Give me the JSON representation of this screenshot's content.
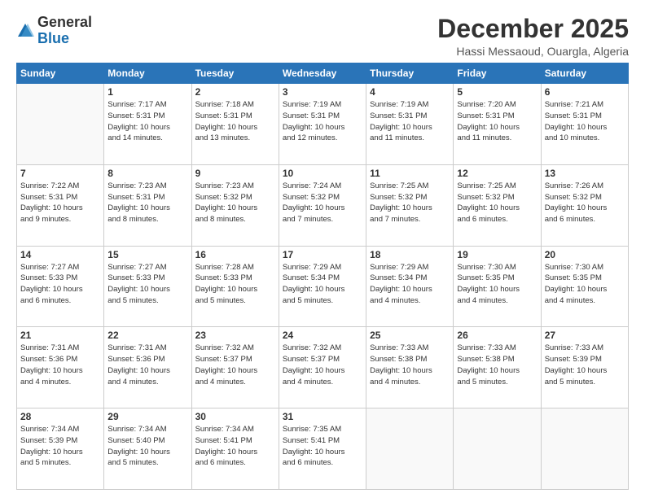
{
  "logo": {
    "general": "General",
    "blue": "Blue"
  },
  "header": {
    "month": "December 2025",
    "location": "Hassi Messaoud, Ouargla, Algeria"
  },
  "days_of_week": [
    "Sunday",
    "Monday",
    "Tuesday",
    "Wednesday",
    "Thursday",
    "Friday",
    "Saturday"
  ],
  "weeks": [
    [
      {
        "day": "",
        "info": ""
      },
      {
        "day": "1",
        "info": "Sunrise: 7:17 AM\nSunset: 5:31 PM\nDaylight: 10 hours\nand 14 minutes."
      },
      {
        "day": "2",
        "info": "Sunrise: 7:18 AM\nSunset: 5:31 PM\nDaylight: 10 hours\nand 13 minutes."
      },
      {
        "day": "3",
        "info": "Sunrise: 7:19 AM\nSunset: 5:31 PM\nDaylight: 10 hours\nand 12 minutes."
      },
      {
        "day": "4",
        "info": "Sunrise: 7:19 AM\nSunset: 5:31 PM\nDaylight: 10 hours\nand 11 minutes."
      },
      {
        "day": "5",
        "info": "Sunrise: 7:20 AM\nSunset: 5:31 PM\nDaylight: 10 hours\nand 11 minutes."
      },
      {
        "day": "6",
        "info": "Sunrise: 7:21 AM\nSunset: 5:31 PM\nDaylight: 10 hours\nand 10 minutes."
      }
    ],
    [
      {
        "day": "7",
        "info": "Sunrise: 7:22 AM\nSunset: 5:31 PM\nDaylight: 10 hours\nand 9 minutes."
      },
      {
        "day": "8",
        "info": "Sunrise: 7:23 AM\nSunset: 5:31 PM\nDaylight: 10 hours\nand 8 minutes."
      },
      {
        "day": "9",
        "info": "Sunrise: 7:23 AM\nSunset: 5:32 PM\nDaylight: 10 hours\nand 8 minutes."
      },
      {
        "day": "10",
        "info": "Sunrise: 7:24 AM\nSunset: 5:32 PM\nDaylight: 10 hours\nand 7 minutes."
      },
      {
        "day": "11",
        "info": "Sunrise: 7:25 AM\nSunset: 5:32 PM\nDaylight: 10 hours\nand 7 minutes."
      },
      {
        "day": "12",
        "info": "Sunrise: 7:25 AM\nSunset: 5:32 PM\nDaylight: 10 hours\nand 6 minutes."
      },
      {
        "day": "13",
        "info": "Sunrise: 7:26 AM\nSunset: 5:32 PM\nDaylight: 10 hours\nand 6 minutes."
      }
    ],
    [
      {
        "day": "14",
        "info": "Sunrise: 7:27 AM\nSunset: 5:33 PM\nDaylight: 10 hours\nand 6 minutes."
      },
      {
        "day": "15",
        "info": "Sunrise: 7:27 AM\nSunset: 5:33 PM\nDaylight: 10 hours\nand 5 minutes."
      },
      {
        "day": "16",
        "info": "Sunrise: 7:28 AM\nSunset: 5:33 PM\nDaylight: 10 hours\nand 5 minutes."
      },
      {
        "day": "17",
        "info": "Sunrise: 7:29 AM\nSunset: 5:34 PM\nDaylight: 10 hours\nand 5 minutes."
      },
      {
        "day": "18",
        "info": "Sunrise: 7:29 AM\nSunset: 5:34 PM\nDaylight: 10 hours\nand 4 minutes."
      },
      {
        "day": "19",
        "info": "Sunrise: 7:30 AM\nSunset: 5:35 PM\nDaylight: 10 hours\nand 4 minutes."
      },
      {
        "day": "20",
        "info": "Sunrise: 7:30 AM\nSunset: 5:35 PM\nDaylight: 10 hours\nand 4 minutes."
      }
    ],
    [
      {
        "day": "21",
        "info": "Sunrise: 7:31 AM\nSunset: 5:36 PM\nDaylight: 10 hours\nand 4 minutes."
      },
      {
        "day": "22",
        "info": "Sunrise: 7:31 AM\nSunset: 5:36 PM\nDaylight: 10 hours\nand 4 minutes."
      },
      {
        "day": "23",
        "info": "Sunrise: 7:32 AM\nSunset: 5:37 PM\nDaylight: 10 hours\nand 4 minutes."
      },
      {
        "day": "24",
        "info": "Sunrise: 7:32 AM\nSunset: 5:37 PM\nDaylight: 10 hours\nand 4 minutes."
      },
      {
        "day": "25",
        "info": "Sunrise: 7:33 AM\nSunset: 5:38 PM\nDaylight: 10 hours\nand 4 minutes."
      },
      {
        "day": "26",
        "info": "Sunrise: 7:33 AM\nSunset: 5:38 PM\nDaylight: 10 hours\nand 5 minutes."
      },
      {
        "day": "27",
        "info": "Sunrise: 7:33 AM\nSunset: 5:39 PM\nDaylight: 10 hours\nand 5 minutes."
      }
    ],
    [
      {
        "day": "28",
        "info": "Sunrise: 7:34 AM\nSunset: 5:39 PM\nDaylight: 10 hours\nand 5 minutes."
      },
      {
        "day": "29",
        "info": "Sunrise: 7:34 AM\nSunset: 5:40 PM\nDaylight: 10 hours\nand 5 minutes."
      },
      {
        "day": "30",
        "info": "Sunrise: 7:34 AM\nSunset: 5:41 PM\nDaylight: 10 hours\nand 6 minutes."
      },
      {
        "day": "31",
        "info": "Sunrise: 7:35 AM\nSunset: 5:41 PM\nDaylight: 10 hours\nand 6 minutes."
      },
      {
        "day": "",
        "info": ""
      },
      {
        "day": "",
        "info": ""
      },
      {
        "day": "",
        "info": ""
      }
    ]
  ]
}
